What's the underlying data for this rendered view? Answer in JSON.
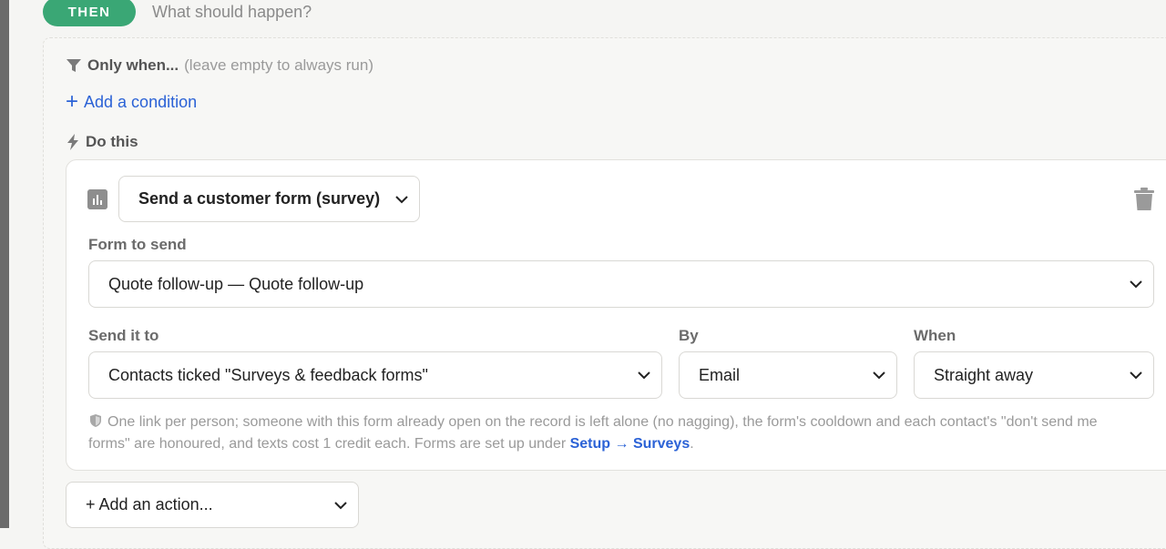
{
  "then": {
    "badge": "THEN",
    "prompt": "What should happen?"
  },
  "only_when": {
    "label": "Only when...",
    "hint": "(leave empty to always run)"
  },
  "add_condition": {
    "label": "Add a condition"
  },
  "do_this": {
    "label": "Do this"
  },
  "action": {
    "type_value": "Send a customer form (survey)",
    "form_label": "Form to send",
    "form_value": "Quote follow-up — Quote follow-up",
    "send_to_label": "Send it to",
    "send_to_value": "Contacts ticked \"Surveys & feedback forms\"",
    "by_label": "By",
    "by_value": "Email",
    "when_label": "When",
    "when_value": "Straight away",
    "note_text": "One link per person; someone with this form already open on the record is left alone (no nagging), the form's cooldown and each contact's \"don't send me forms\" are honoured, and texts cost 1 credit each. Forms are set up under ",
    "note_link": "Setup → Surveys",
    "note_end": "."
  },
  "add_action": {
    "label": "+ Add an action..."
  },
  "icons": {
    "filter": "filter-icon",
    "bolt": "bolt-icon",
    "chart": "bar-chart-icon",
    "trash": "trash-icon",
    "shield": "shield-icon",
    "chevron": "chevron-down-icon"
  },
  "colors": {
    "accent_green": "#3aa775",
    "link_blue": "#2b62d6"
  }
}
